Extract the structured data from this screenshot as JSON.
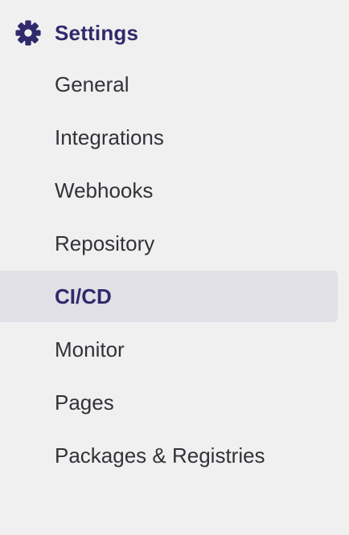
{
  "section": {
    "title": "Settings",
    "icon": "gear-icon",
    "accent_color": "#2f2a6b"
  },
  "nav": {
    "active_index": 4,
    "items": [
      {
        "label": "General"
      },
      {
        "label": "Integrations"
      },
      {
        "label": "Webhooks"
      },
      {
        "label": "Repository"
      },
      {
        "label": "CI/CD"
      },
      {
        "label": "Monitor"
      },
      {
        "label": "Pages"
      },
      {
        "label": "Packages & Registries"
      }
    ]
  }
}
